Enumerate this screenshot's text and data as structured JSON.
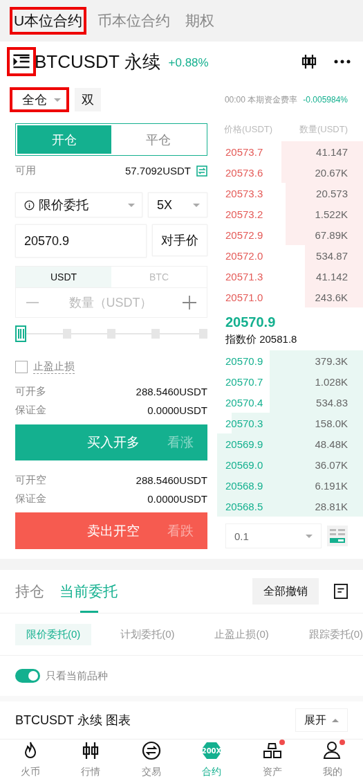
{
  "top_tabs": [
    {
      "label": "U本位合约",
      "selected": true,
      "highlighted": true
    },
    {
      "label": "币本位合约",
      "selected": false,
      "highlighted": false
    },
    {
      "label": "期权",
      "selected": false,
      "highlighted": false
    }
  ],
  "header": {
    "menu_highlighted": true,
    "symbol": "BTCUSDT 永续",
    "change": "+0.88%"
  },
  "margin_mode": {
    "label": "全仓",
    "highlighted": true
  },
  "position_mode": "双",
  "funding": {
    "time": "00:00",
    "label": "本期资金费率",
    "rate": "-0.005984%"
  },
  "order_form": {
    "sides": [
      {
        "label": "开仓",
        "selected": true
      },
      {
        "label": "平仓",
        "selected": false
      }
    ],
    "available_label": "可用",
    "available": "57.7092USDT",
    "order_type": "限价委托",
    "leverage": "5X",
    "price": "20570.9",
    "counterparty_button": "对手价",
    "units": [
      {
        "label": "USDT",
        "selected": true
      },
      {
        "label": "BTC",
        "selected": false
      }
    ],
    "quantity_placeholder": "数量（USDT）",
    "tpsl": {
      "label": "止盈止损",
      "checked": false
    },
    "long": {
      "rows": [
        {
          "label": "可开多",
          "value": "288.5460USDT"
        },
        {
          "label": "保证金",
          "value": "0.0000USDT"
        }
      ],
      "button": "买入开多",
      "hint": "看涨"
    },
    "short": {
      "rows": [
        {
          "label": "可开空",
          "value": "288.5460USDT"
        },
        {
          "label": "保证金",
          "value": "0.0000USDT"
        }
      ],
      "button": "卖出开空",
      "hint": "看跌"
    }
  },
  "order_book": {
    "columns": [
      "价格(USDT)",
      "数量(USDT)"
    ],
    "asks": [
      {
        "price": "20573.7",
        "amount": "41.147"
      },
      {
        "price": "20573.6",
        "amount": "20.67K"
      },
      {
        "price": "20573.3",
        "amount": "20.573"
      },
      {
        "price": "20573.2",
        "amount": "1.522K"
      },
      {
        "price": "20572.9",
        "amount": "67.89K"
      },
      {
        "price": "20572.0",
        "amount": "534.87"
      },
      {
        "price": "20571.3",
        "amount": "41.142"
      },
      {
        "price": "20571.0",
        "amount": "243.6K"
      }
    ],
    "last_price": "20570.9",
    "index_label": "指数价",
    "index_price": "20581.8",
    "bids": [
      {
        "price": "20570.9",
        "amount": "379.3K"
      },
      {
        "price": "20570.7",
        "amount": "1.028K"
      },
      {
        "price": "20570.4",
        "amount": "534.83"
      },
      {
        "price": "20570.3",
        "amount": "158.0K"
      },
      {
        "price": "20569.9",
        "amount": "48.48K"
      },
      {
        "price": "20569.0",
        "amount": "36.07K"
      },
      {
        "price": "20568.9",
        "amount": "6.191K"
      },
      {
        "price": "20568.5",
        "amount": "28.81K"
      }
    ],
    "depth": "0.1"
  },
  "orders": {
    "tabs": [
      {
        "label": "持仓",
        "selected": false
      },
      {
        "label": "当前委托",
        "selected": true
      }
    ],
    "cancel_all": "全部撤销",
    "filters": [
      {
        "label": "限价委托(0)",
        "selected": true
      },
      {
        "label": "计划委托(0)",
        "selected": false
      },
      {
        "label": "止盈止损(0)",
        "selected": false
      },
      {
        "label": "跟踪委托(0)",
        "selected": false
      }
    ],
    "toggle": {
      "label": "只看当前品种",
      "on": true
    },
    "chart_bar": {
      "title": "BTCUSDT 永续 图表",
      "button": "展开"
    }
  },
  "bottom_nav": [
    {
      "kind": "flame",
      "label": "火币",
      "selected": false,
      "badge": false
    },
    {
      "kind": "candles",
      "label": "行情",
      "selected": false,
      "badge": false
    },
    {
      "kind": "exchange",
      "label": "交易",
      "selected": false,
      "badge": false
    },
    {
      "kind": "contract",
      "label": "合约",
      "selected": true,
      "badge": false,
      "icon_text": "200X"
    },
    {
      "kind": "assets",
      "label": "资产",
      "selected": false,
      "badge": true
    },
    {
      "kind": "person",
      "label": "我的",
      "selected": false,
      "badge": true
    }
  ]
}
